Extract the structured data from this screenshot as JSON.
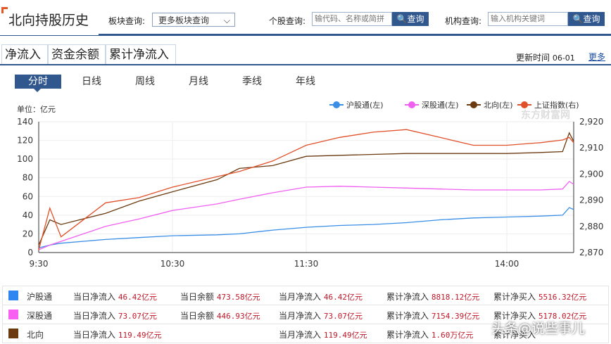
{
  "header": {
    "title": "北向持股历史",
    "sector_label": "板块查询:",
    "sector_value": "更多板块查询",
    "stock_label": "个股查询:",
    "stock_placeholder": "输代码、名称或简拼",
    "org_label": "机构查询:",
    "org_placeholder": "输入机构关键词",
    "search_btn": "查询"
  },
  "tabs": [
    {
      "label": "净流入",
      "active": true
    },
    {
      "label": "资金余额"
    },
    {
      "label": "累计净流入"
    }
  ],
  "update": {
    "label": "更新时间",
    "date": "06-01",
    "more": "更多"
  },
  "periods": [
    "分时",
    "日线",
    "周线",
    "月线",
    "季线",
    "年线"
  ],
  "unit": "单位：亿元",
  "watermark": "东方财富网",
  "chart_data": {
    "type": "line",
    "x_ticks": [
      "9:30",
      "10:30",
      "11:30",
      "14:00"
    ],
    "y_left_ticks": [
      0,
      20,
      40,
      60,
      80,
      100,
      120,
      140
    ],
    "y_right_ticks": [
      "2,870",
      "2,880",
      "2,890",
      "2,900",
      "2,910",
      "2,920"
    ],
    "ylim_left": [
      0,
      140
    ],
    "ylim_right": [
      2870,
      2920
    ],
    "x_minutes": [
      0,
      5,
      10,
      30,
      45,
      60,
      80,
      90,
      105,
      120,
      135,
      150,
      165,
      180,
      195,
      210,
      225,
      235,
      238,
      240
    ],
    "series": [
      {
        "name": "沪股通(左)",
        "color": "#3a8ee6",
        "axis": "left",
        "values": [
          5,
          8,
          10,
          14,
          16,
          18,
          19,
          20,
          24,
          27,
          29,
          30,
          32,
          35,
          37,
          38,
          39,
          40,
          48,
          46
        ]
      },
      {
        "name": "深股通(左)",
        "color": "#f060f0",
        "axis": "left",
        "values": [
          3,
          8,
          12,
          28,
          36,
          45,
          52,
          57,
          64,
          70,
          71,
          70,
          69,
          68,
          67,
          67,
          67,
          68,
          76,
          73
        ]
      },
      {
        "name": "北向(左)",
        "color": "#6b3a10",
        "axis": "left",
        "values": [
          8,
          35,
          30,
          42,
          55,
          65,
          78,
          90,
          93,
          103,
          104,
          105,
          106,
          106,
          106,
          106,
          107,
          108,
          128,
          119
        ]
      },
      {
        "name": "上证指数(右)",
        "color": "#e0502a",
        "axis": "right",
        "values": [
          2871,
          2887,
          2876,
          2889,
          2891,
          2895,
          2899,
          2901,
          2905,
          2911,
          2914,
          2916,
          2917,
          2914,
          2911,
          2911,
          2912,
          2913,
          2914,
          2912
        ]
      }
    ]
  },
  "summary": [
    {
      "name": "沪股通",
      "color": "#2f86f0",
      "cells": [
        [
          "当日净流入",
          "46.42亿元"
        ],
        [
          "当日余额",
          "473.58亿元"
        ],
        [
          "当月净流入",
          "46.42亿元"
        ],
        [
          "累计净流入",
          "8818.12亿元"
        ],
        [
          "累计净买入",
          "5516.32亿元"
        ]
      ]
    },
    {
      "name": "深股通",
      "color": "#f760f0",
      "cells": [
        [
          "当日净流入",
          "73.07亿元"
        ],
        [
          "当日余额",
          "446.93亿元"
        ],
        [
          "当月净流入",
          "73.07亿元"
        ],
        [
          "累计净流入",
          "7154.39亿元"
        ],
        [
          "累计净买入",
          "5178.02亿元"
        ]
      ]
    },
    {
      "name": "北向",
      "color": "#6b3a0e",
      "cells": [
        [
          "当日净流入",
          "119.49亿元"
        ],
        [
          "",
          ""
        ],
        [
          "当月净流入",
          "119.49亿元"
        ],
        [
          "累计净流入",
          "1.60万亿元"
        ],
        [
          "累计净买入",
          ""
        ]
      ]
    }
  ],
  "overlay": "头条@说些事儿"
}
